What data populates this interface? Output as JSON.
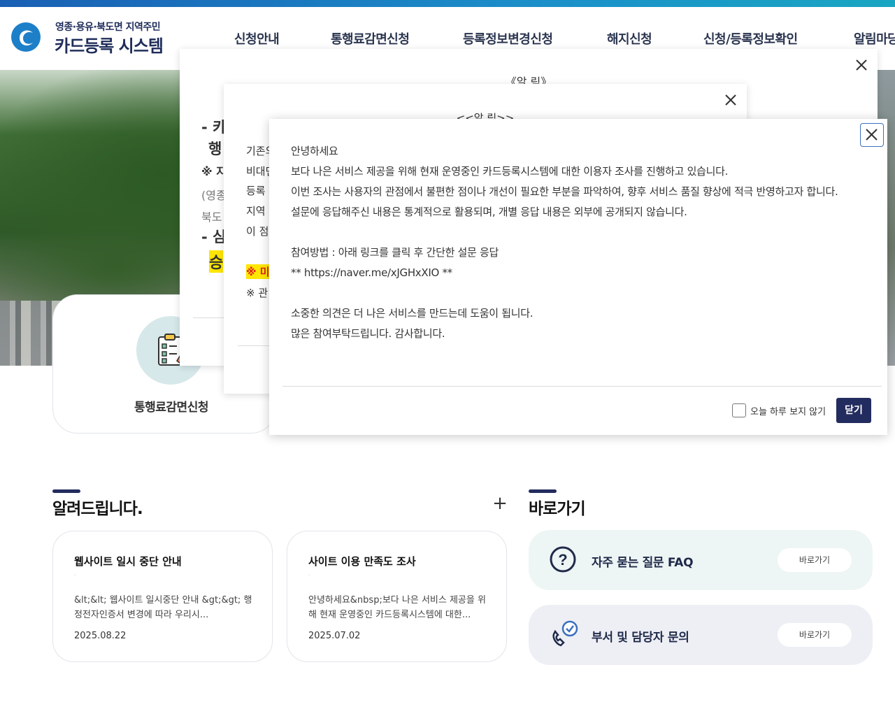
{
  "header": {
    "logo_subtitle": "영종·용유·북도면 지역주민",
    "logo_title": "카드등록 시스템",
    "nav": [
      "신청안내",
      "통행료감면신청",
      "등록정보변경신청",
      "해지신청",
      "신청/등록정보확인",
      "알림마당"
    ]
  },
  "quick_menu": {
    "label": "통행료감면신청",
    "icon": "clipboard-checklist-icon"
  },
  "notices": {
    "title": "알려드립니다.",
    "more_icon": "plus-icon",
    "items": [
      {
        "title": "웹사이트 일시 중단 안내",
        "excerpt": "&lt;&lt; 웹사이트 일시중단 안내 &gt;&gt; 행정전자인증서 변경에 따라 우리시...",
        "date": "2025.08.22"
      },
      {
        "title": "사이트 이용 만족도 조사",
        "excerpt": "안녕하세요&nbsp;보다 나은 서비스 제공을 위해 현재 운영중인 카드등록시스템에 대한...",
        "date": "2025.07.02"
      }
    ]
  },
  "shortcuts": {
    "title": "바로가기",
    "items": [
      {
        "label": "자주 묻는 질문 FAQ",
        "button": "바로가기",
        "icon": "question-circle-icon",
        "bg": "#eef5f5"
      },
      {
        "label": "부서 및 담당자 문의",
        "button": "바로가기",
        "icon": "phone-chat-icon",
        "bg": "#eeeff5"
      }
    ]
  },
  "popup_back": {
    "heading": "《알 림》",
    "fragments": [
      "- 카",
      "행",
      "※ 지",
      "(영종",
      "북도",
      "- 심",
      "승"
    ]
  },
  "popup_middle": {
    "heading": "<<알 림>>",
    "fragments": [
      "기존의",
      "비대면",
      "등록",
      "지역",
      "이 점",
      "※ 미",
      "※ 관"
    ]
  },
  "popup_front": {
    "lines": [
      "안녕하세요",
      "보다 나은 서비스 제공을 위해 현재 운영중인 카드등록시스템에 대한 이용자 조사를 진행하고 있습니다.",
      "이번 조사는 사용자의 관점에서 불편한 점이나 개선이 필요한 부분을 파악하여, 향후 서비스 품질 향상에 적극 반영하고자 합니다.",
      "설문에 응답해주신 내용은 통계적으로 활용되며, 개별 응답 내용은 외부에 공개되지 않습니다.",
      "",
      "참여방법 : 아래 링크를 클릭 후 간단한 설문 응답",
      "** https://naver.me/xJGHxXIO **",
      "",
      "소중한 의견은 더 나은 서비스를 만드는데 도움이 됩니다.",
      "많은 참여부탁드립니다. 감사합니다."
    ],
    "dont_show_today": "오늘 하루 보지 않기",
    "close_button": "닫기"
  },
  "colors": {
    "navy": "#232c5e",
    "accent_blue": "#1b8fc9",
    "highlight_yellow": "#ffe600"
  }
}
